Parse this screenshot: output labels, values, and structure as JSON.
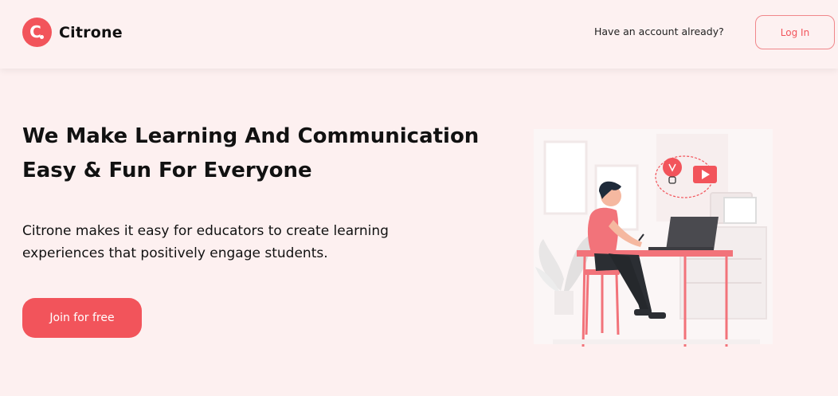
{
  "brand": {
    "name": "Citrone",
    "logo_letter": "C"
  },
  "header": {
    "account_prompt": "Have an account already?",
    "login_label": "Log In"
  },
  "hero": {
    "headline_line1": "We Make Learning And Communication",
    "headline_line2": "Easy & Fun For Everyone",
    "subtext_line1": "Citrone makes it easy for educators to create learning",
    "subtext_line2": "experiences that positively engage students.",
    "cta_label": "Join for free"
  },
  "colors": {
    "accent": "#f2545b",
    "background": "#fdf0f0",
    "text": "#111111"
  },
  "icons": [
    "logo-mark-icon",
    "lightbulb-icon",
    "play-icon"
  ]
}
